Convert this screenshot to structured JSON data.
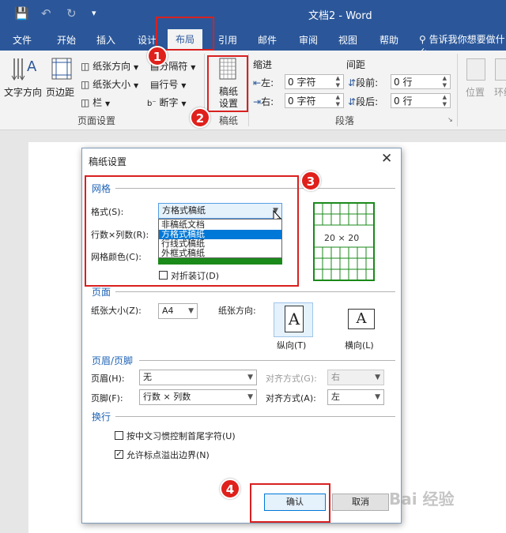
{
  "window": {
    "title": "文档2  -  Word"
  },
  "tabs": [
    {
      "label": "文件"
    },
    {
      "label": "开始"
    },
    {
      "label": "插入"
    },
    {
      "label": "设计"
    },
    {
      "label": "布局"
    },
    {
      "label": "引用"
    },
    {
      "label": "邮件"
    },
    {
      "label": "审阅"
    },
    {
      "label": "视图"
    },
    {
      "label": "帮助"
    }
  ],
  "tell_me": "告诉我你想要做什么",
  "ribbon": {
    "text_direction": "文字方向",
    "margins": "页边距",
    "orientation": "纸张方向",
    "size": "纸张大小",
    "columns": "栏",
    "breaks": "分隔符",
    "line_numbers": "行号",
    "hyphenation": "断字",
    "page_setup_group": "页面设置",
    "manuscript_settings_l1": "稿纸",
    "manuscript_settings_l2": "设置",
    "manuscript_group": "稿纸",
    "indent": "缩进",
    "spacing": "间距",
    "indent_left_label": "左:",
    "indent_left_value": "0 字符",
    "indent_right_label": "右:",
    "indent_right_value": "0 字符",
    "spacing_before_label": "段前:",
    "spacing_before_value": "0 行",
    "spacing_after_label": "段后:",
    "spacing_after_value": "0 行",
    "paragraph_group": "段落",
    "position": "位置",
    "wrap_text": "环绕"
  },
  "dialog": {
    "title": "稿纸设置",
    "grid_section": "网格",
    "style_label": "格式(S):",
    "style_value": "方格式稿纸",
    "style_options": [
      "非稿纸文档",
      "方格式稿纸",
      "行线式稿纸",
      "外框式稿纸"
    ],
    "style_selected_index": 1,
    "rows_cols_label": "行数×列数(R):",
    "grid_color_label": "网格颜色(C):",
    "fold_binding_label": "对折装订(D)",
    "preview_text": "20 × 20",
    "page_section": "页面",
    "paper_size_label": "纸张大小(Z):",
    "paper_size_value": "A4",
    "orientation_label": "纸张方向:",
    "portrait_label": "纵向(T)",
    "landscape_label": "横向(L)",
    "orientation_glyph": "A",
    "header_footer_section": "页眉/页脚",
    "header_label": "页眉(H):",
    "header_value": "无",
    "header_align_label": "对齐方式(G):",
    "header_align_value": "右",
    "footer_label": "页脚(F):",
    "footer_value": "行数 × 列数",
    "footer_align_label": "对齐方式(A):",
    "footer_align_value": "左",
    "line_break_section": "换行",
    "chinese_rules_label": "按中文习惯控制首尾字符(U)",
    "overflow_label": "允许标点溢出边界(N)",
    "ok_label": "确认",
    "cancel_label": "取消"
  },
  "badges": [
    "1",
    "2",
    "3",
    "4"
  ],
  "watermark": "Bai 经验",
  "colors": {
    "accent": "#2b579a",
    "red": "#d92020",
    "grid_green": "#1a8a1a"
  }
}
